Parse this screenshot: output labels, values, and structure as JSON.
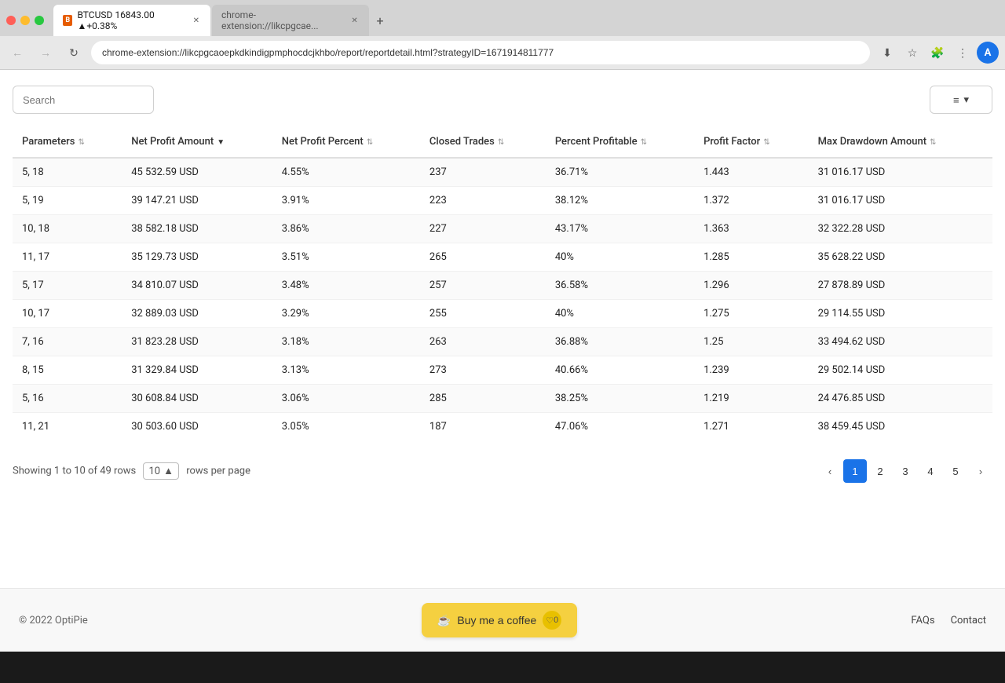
{
  "browser": {
    "tab1_favicon": "B",
    "tab1_label": "BTCUSD 16843.00 ▲+0.38%",
    "tab2_label": "chrome-extension://likcpgcae...",
    "address_bar_value": "chrome-extension://likcpgcaoepkdkindigpmphocdcjkhbo/report/reportdetail.html?strategyID=1671914811777",
    "back_btn": "←",
    "forward_btn": "→",
    "refresh_btn": "↻",
    "new_tab_btn": "+",
    "profile_initial": "A"
  },
  "page": {
    "search_placeholder": "Search",
    "filter_icon": "≡",
    "filter_dropdown_icon": "▾"
  },
  "table": {
    "columns": [
      {
        "key": "parameters",
        "label": "Parameters",
        "sortable": true,
        "sort_active": false
      },
      {
        "key": "net_profit_amount",
        "label": "Net Profit Amount",
        "sortable": true,
        "sort_active": true
      },
      {
        "key": "net_profit_percent",
        "label": "Net Profit Percent",
        "sortable": true,
        "sort_active": false
      },
      {
        "key": "closed_trades",
        "label": "Closed Trades",
        "sortable": true,
        "sort_active": false
      },
      {
        "key": "percent_profitable",
        "label": "Percent Profitable",
        "sortable": true,
        "sort_active": false
      },
      {
        "key": "profit_factor",
        "label": "Profit Factor",
        "sortable": true,
        "sort_active": false
      },
      {
        "key": "max_drawdown_amount",
        "label": "Max Drawdown Amount",
        "sortable": true,
        "sort_active": false
      }
    ],
    "rows": [
      {
        "parameters": "5, 18",
        "net_profit_amount": "45 532.59 USD",
        "net_profit_percent": "4.55%",
        "closed_trades": "237",
        "percent_profitable": "36.71%",
        "profit_factor": "1.443",
        "max_drawdown_amount": "31 016.17 USD"
      },
      {
        "parameters": "5, 19",
        "net_profit_amount": "39 147.21 USD",
        "net_profit_percent": "3.91%",
        "closed_trades": "223",
        "percent_profitable": "38.12%",
        "profit_factor": "1.372",
        "max_drawdown_amount": "31 016.17 USD"
      },
      {
        "parameters": "10, 18",
        "net_profit_amount": "38 582.18 USD",
        "net_profit_percent": "3.86%",
        "closed_trades": "227",
        "percent_profitable": "43.17%",
        "profit_factor": "1.363",
        "max_drawdown_amount": "32 322.28 USD"
      },
      {
        "parameters": "11, 17",
        "net_profit_amount": "35 129.73 USD",
        "net_profit_percent": "3.51%",
        "closed_trades": "265",
        "percent_profitable": "40%",
        "profit_factor": "1.285",
        "max_drawdown_amount": "35 628.22 USD"
      },
      {
        "parameters": "5, 17",
        "net_profit_amount": "34 810.07 USD",
        "net_profit_percent": "3.48%",
        "closed_trades": "257",
        "percent_profitable": "36.58%",
        "profit_factor": "1.296",
        "max_drawdown_amount": "27 878.89 USD"
      },
      {
        "parameters": "10, 17",
        "net_profit_amount": "32 889.03 USD",
        "net_profit_percent": "3.29%",
        "closed_trades": "255",
        "percent_profitable": "40%",
        "profit_factor": "1.275",
        "max_drawdown_amount": "29 114.55 USD"
      },
      {
        "parameters": "7, 16",
        "net_profit_amount": "31 823.28 USD",
        "net_profit_percent": "3.18%",
        "closed_trades": "263",
        "percent_profitable": "36.88%",
        "profit_factor": "1.25",
        "max_drawdown_amount": "33 494.62 USD"
      },
      {
        "parameters": "8, 15",
        "net_profit_amount": "31 329.84 USD",
        "net_profit_percent": "3.13%",
        "closed_trades": "273",
        "percent_profitable": "40.66%",
        "profit_factor": "1.239",
        "max_drawdown_amount": "29 502.14 USD"
      },
      {
        "parameters": "5, 16",
        "net_profit_amount": "30 608.84 USD",
        "net_profit_percent": "3.06%",
        "closed_trades": "285",
        "percent_profitable": "38.25%",
        "profit_factor": "1.219",
        "max_drawdown_amount": "24 476.85 USD"
      },
      {
        "parameters": "11, 21",
        "net_profit_amount": "30 503.60 USD",
        "net_profit_percent": "3.05%",
        "closed_trades": "187",
        "percent_profitable": "47.06%",
        "profit_factor": "1.271",
        "max_drawdown_amount": "38 459.45 USD"
      }
    ]
  },
  "pagination": {
    "showing_text": "Showing 1 to 10 of 49 rows",
    "rows_per_page": "10",
    "rows_per_page_dropdown": "▲",
    "rows_per_page_suffix": "rows per page",
    "pages": [
      "1",
      "2",
      "3",
      "4",
      "5"
    ],
    "active_page": "1",
    "prev_icon": "‹",
    "next_icon": "›"
  },
  "footer": {
    "copyright": "© 2022 OptiPie",
    "buy_coffee_label": "Buy me a coffee",
    "buy_coffee_icon": "☕",
    "heart_count": "0",
    "faqs_label": "FAQs",
    "contact_label": "Contact"
  }
}
